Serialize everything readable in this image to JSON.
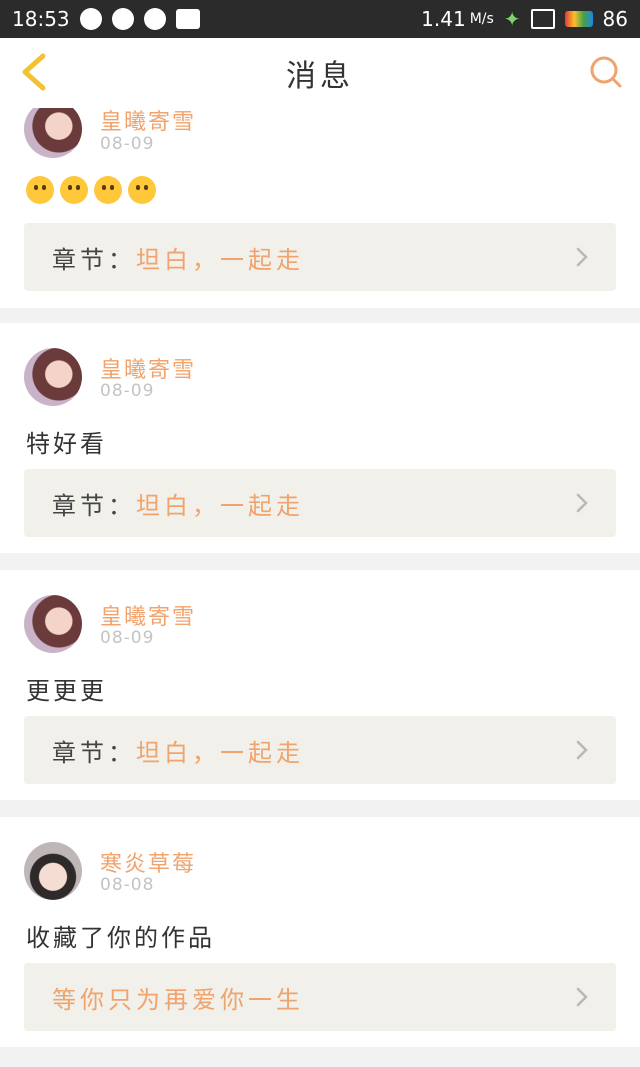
{
  "status_bar": {
    "time": "18:53",
    "network_speed": "1.41",
    "speed_unit": "M/s",
    "battery": "86"
  },
  "header": {
    "title": "消息",
    "back_icon": "chevron-left-icon",
    "search_icon": "search-icon"
  },
  "colors": {
    "accent": "#f0a36d",
    "back_arrow": "#f2c230",
    "chapter_bg": "#f1f0ea"
  },
  "messages": [
    {
      "username": "皇曦寄雪",
      "date": "08-09",
      "content": "",
      "emojis": [
        "grinning-face-emoji",
        "kissing-heart-emoji",
        "kissing-heart-emoji",
        "kissing-heart-emoji"
      ],
      "chapter_prefix": "章节：",
      "chapter_title": "坦白，一起走"
    },
    {
      "username": "皇曦寄雪",
      "date": "08-09",
      "content": "特好看",
      "chapter_prefix": "章节：",
      "chapter_title": "坦白，一起走"
    },
    {
      "username": "皇曦寄雪",
      "date": "08-09",
      "content": "更更更",
      "chapter_prefix": "章节：",
      "chapter_title": "坦白，一起走"
    },
    {
      "username": "寒炎草莓",
      "date": "08-08",
      "content": "收藏了你的作品",
      "chapter_prefix": "",
      "chapter_title": "等你只为再爱你一生"
    }
  ]
}
